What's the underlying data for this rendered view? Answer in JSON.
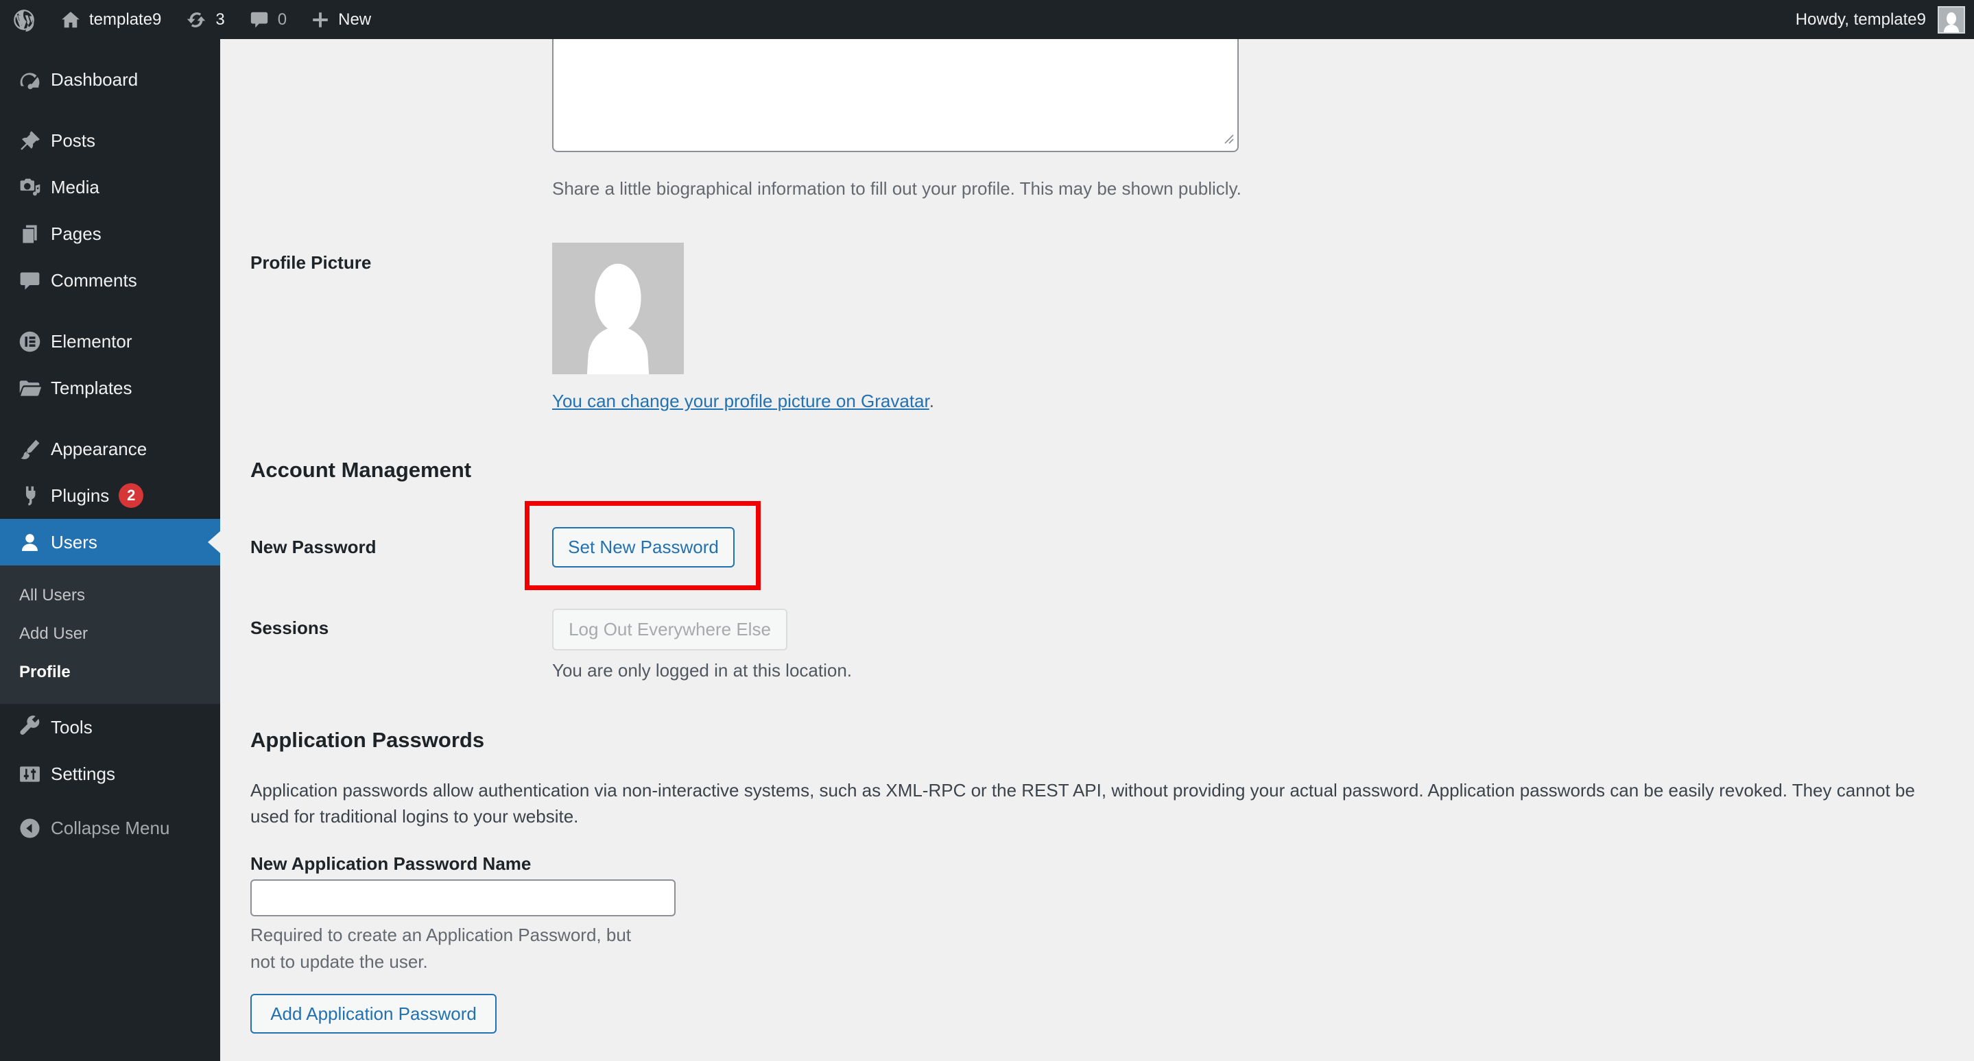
{
  "admin_bar": {
    "site_name": "template9",
    "updates_count": "3",
    "comments_count": "0",
    "new_label": "New",
    "howdy": "Howdy, template9"
  },
  "sidebar": {
    "items": [
      {
        "label": "Dashboard"
      },
      {
        "label": "Posts"
      },
      {
        "label": "Media"
      },
      {
        "label": "Pages"
      },
      {
        "label": "Comments"
      },
      {
        "label": "Elementor"
      },
      {
        "label": "Templates"
      },
      {
        "label": "Appearance"
      },
      {
        "label": "Plugins",
        "badge": "2"
      },
      {
        "label": "Users",
        "active": true
      },
      {
        "label": "Tools"
      },
      {
        "label": "Settings"
      }
    ],
    "submenu": [
      {
        "label": "All Users"
      },
      {
        "label": "Add User"
      },
      {
        "label": "Profile",
        "current": true
      }
    ],
    "collapse_label": "Collapse Menu"
  },
  "main": {
    "bio": {
      "value": "",
      "description": "Share a little biographical information to fill out your profile. This may be shown publicly."
    },
    "profile_picture": {
      "label": "Profile Picture",
      "gravatar_link": "You can change your profile picture on Gravatar",
      "gravatar_suffix": "."
    },
    "account_management": {
      "heading": "Account Management",
      "new_password_label": "New Password",
      "set_new_password_button": "Set New Password",
      "sessions_label": "Sessions",
      "logout_button": "Log Out Everywhere Else",
      "sessions_note": "You are only logged in at this location."
    },
    "application_passwords": {
      "heading": "Application Passwords",
      "description": "Application passwords allow authentication via non-interactive systems, such as XML-RPC or the REST API, without providing your actual password. Application passwords can be easily revoked. They cannot be used for traditional logins to your website.",
      "input_label": "New Application Password Name",
      "input_value": "",
      "helper": "Required to create an Application Password, but not to update the user.",
      "add_button": "Add Application Password"
    }
  },
  "colors": {
    "accent_blue": "#2271b1",
    "badge_red": "#d63638",
    "annotation_red": "#f00000",
    "menu_bg": "#1d2327",
    "submenu_bg": "#2c3338",
    "content_bg": "#f0f0f1"
  }
}
